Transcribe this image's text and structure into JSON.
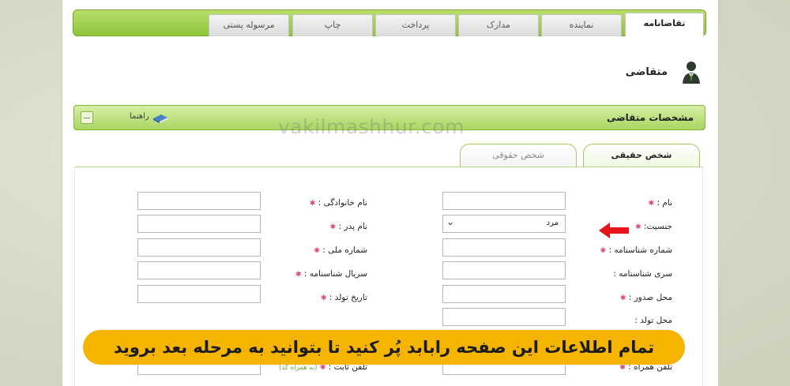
{
  "tabs": [
    {
      "label": "تقاضانامه",
      "active": true
    },
    {
      "label": "نماینده",
      "active": false
    },
    {
      "label": "مدارک",
      "active": false
    },
    {
      "label": "پرداخت",
      "active": false
    },
    {
      "label": "چاپ",
      "active": false
    },
    {
      "label": "مرسوله پستی",
      "active": false
    }
  ],
  "person_heading": "متقاضی",
  "section": {
    "title": "مشخصات متقاضی",
    "help_label": "راهنما"
  },
  "watermark": "vakilmashhur.com",
  "person_tabs": {
    "real": "شخص حقیقی",
    "legal": "شخص حقوقی"
  },
  "form": {
    "right_labels": [
      "نام :",
      "جنسیت:",
      "شماره شناسنامه :",
      "سری شناسنامه :",
      "محل صدور :",
      "محل تولد :",
      "تلفن همراه :"
    ],
    "left_labels": [
      "نام خانوادگی :",
      "نام پدر :",
      "شماره ملی :",
      "سریال شناسنامه :",
      "تاریخ تولد :",
      "تلفن ثابت :"
    ],
    "gender_value": "مرد",
    "phone_hint": "(به همراه کد)"
  },
  "banner_text": "تمام اطلاعات این صفحه رابابد پُر کنید تا بتوانید به مرحله بعد بروید",
  "colors": {
    "accent_green": "#8fc43a",
    "banner": "#f4b400",
    "required": "#e0457a",
    "arrow": "#e8141c"
  }
}
